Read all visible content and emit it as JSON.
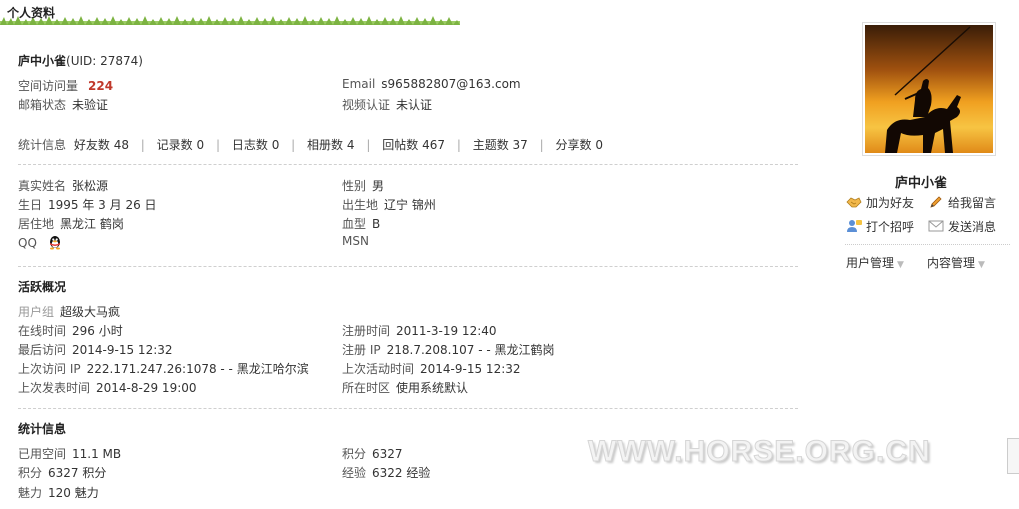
{
  "header": {
    "title": "个人资料"
  },
  "profile": {
    "name": "庐中小雀",
    "uid": "(UID: 27874)",
    "visits_label": "空间访问量",
    "visits_value": "224",
    "mail_status_label": "邮箱状态",
    "mail_status_value": "未验证",
    "email_label": "Email",
    "email_value": "s965882807@163.com",
    "video_label": "视频认证",
    "video_value": "未认证"
  },
  "stats": {
    "prefix": "统计信息",
    "items": [
      {
        "label": "好友数",
        "value": "48"
      },
      {
        "label": "记录数",
        "value": "0"
      },
      {
        "label": "日志数",
        "value": "0"
      },
      {
        "label": "相册数",
        "value": "4"
      },
      {
        "label": "回帖数",
        "value": "467"
      },
      {
        "label": "主题数",
        "value": "37"
      },
      {
        "label": "分享数",
        "value": "0"
      }
    ]
  },
  "personal": {
    "realname_label": "真实姓名",
    "realname_value": "张松源",
    "gender_label": "性别",
    "gender_value": "男",
    "birthday_label": "生日",
    "birthday_value": "1995 年 3 月 26 日",
    "birthplace_label": "出生地",
    "birthplace_value": "辽宁 锦州",
    "residence_label": "居住地",
    "residence_value": "黑龙江 鹤岗",
    "blood_label": "血型",
    "blood_value": "B",
    "qq_label": "QQ",
    "msn_label": "MSN"
  },
  "activity": {
    "title": "活跃概况",
    "group_label": "用户组",
    "group_value": "超级大马疯",
    "online_label": "在线时间",
    "online_value": "296 小时",
    "reg_time_label": "注册时间",
    "reg_time_value": "2011-3-19 12:40",
    "last_visit_label": "最后访问",
    "last_visit_value": "2014-9-15 12:32",
    "reg_ip_label": "注册 IP",
    "reg_ip_value": "218.7.208.107 - - 黑龙江鹤岗",
    "last_ip_label": "上次访问 IP",
    "last_ip_value": "222.171.247.26:1078 - - 黑龙江哈尔滨",
    "last_active_label": "上次活动时间",
    "last_active_value": "2014-9-15 12:32",
    "last_post_label": "上次发表时间",
    "last_post_value": "2014-8-29 19:00",
    "timezone_label": "所在时区",
    "timezone_value": "使用系统默认"
  },
  "statistics": {
    "title": "统计信息",
    "space_label": "已用空间",
    "space_value": "11.1 MB",
    "points_label": "积分",
    "points_value": "6327",
    "points2_label": "积分",
    "points2_value": "6327 积分",
    "exp_label": "经验",
    "exp_value": "6322 经验",
    "charm_label": "魅力",
    "charm_value": "120 魅力"
  },
  "sidebar": {
    "name": "庐中小雀",
    "add_friend": "加为好友",
    "leave_message": "给我留言",
    "greet": "打个招呼",
    "send_message": "发送消息",
    "user_manage": "用户管理",
    "content_manage": "内容管理"
  },
  "watermark": "WWW.HORSE.ORG.CN",
  "colors": {
    "accent_red": "#c0392b",
    "grass_green": "#7cb342"
  }
}
